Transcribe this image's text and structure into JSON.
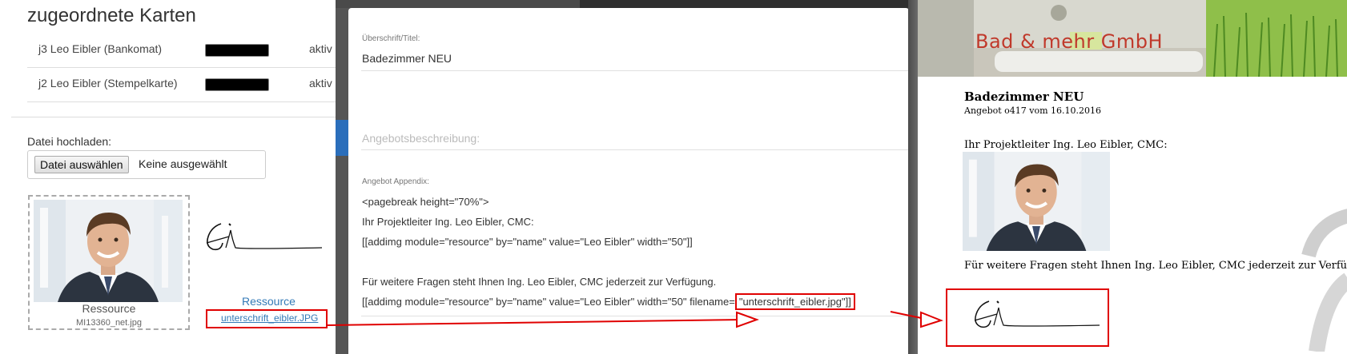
{
  "left": {
    "title": "zugeordnete Karten",
    "cards": [
      {
        "name": "j3 Leo Eibler (Bankomat)",
        "status": "aktiv"
      },
      {
        "name": "j2 Leo Eibler (Stempelkarte)",
        "status": "aktiv"
      }
    ],
    "upload": {
      "label": "Datei hochladen:",
      "button_label": "Datei auswählen",
      "status": "Keine ausgewählt"
    },
    "resources": [
      {
        "caption": "Ressource",
        "filename": "MI13360_net.jpg"
      },
      {
        "caption": "Ressource",
        "filename": "unterschrift_eibler.JPG"
      }
    ]
  },
  "editor": {
    "title_label": "Überschrift/Titel:",
    "title_value": "Badezimmer NEU",
    "description_placeholder": "Angebotsbeschreibung:",
    "appendix_label": "Angebot Appendix:",
    "appendix_lines": [
      "<pagebreak height=\"70%\">",
      "Ihr Projektleiter Ing. Leo Eibler, CMC:",
      "[[addimg module=\"resource\" by=\"name\" value=\"Leo Eibler\" width=\"50\"]]",
      "",
      "Für weitere Fragen steht Ihnen Ing. Leo Eibler, CMC jederzeit zur Verfügung."
    ],
    "appendix_last_prefix": "[[addimg module=\"resource\" by=\"name\" value=\"Leo Eibler\" width=\"50\" filename=",
    "appendix_last_highlight": "\"unterschrift_eibler.jpg\"]]"
  },
  "preview": {
    "company": "Bad & mehr GmbH",
    "doc_title": "Badezimmer NEU",
    "doc_subtitle": "Angebot o417 vom 16.10.2016",
    "leader_text": "Ihr Projektleiter Ing. Leo Eibler, CMC:",
    "closing_text": "Für weitere Fragen steht Ihnen Ing. Leo Eibler, CMC jederzeit zur Verfügung."
  },
  "colors": {
    "highlight": "#e00000",
    "link": "#337ab7",
    "modal_backdrop": "#555555",
    "accent_blue": "#2a6ebb"
  },
  "icons": [
    "portrait-photo",
    "signature-image",
    "annotation-arrow"
  ]
}
